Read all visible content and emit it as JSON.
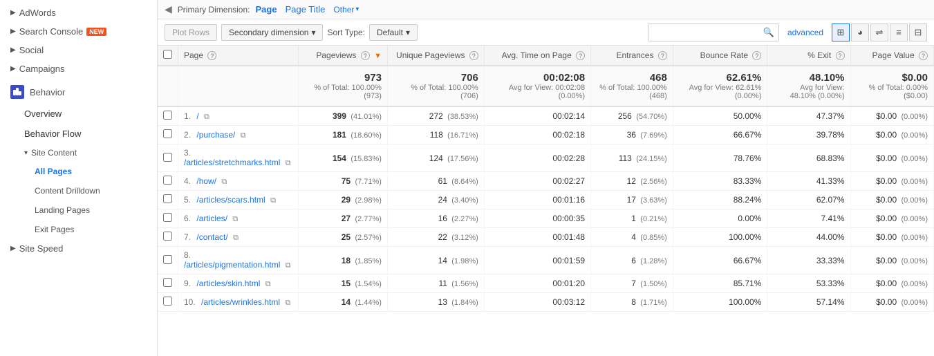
{
  "sidebar": {
    "items": [
      {
        "label": "AdWords",
        "type": "section",
        "arrow": "▶"
      },
      {
        "label": "Search Console",
        "type": "section",
        "arrow": "▶",
        "badge": "NEW"
      },
      {
        "label": "Social",
        "type": "section",
        "arrow": "▶"
      },
      {
        "label": "Campaigns",
        "type": "section",
        "arrow": "▶"
      },
      {
        "label": "Behavior",
        "type": "behavior"
      },
      {
        "label": "Overview",
        "type": "sub"
      },
      {
        "label": "Behavior Flow",
        "type": "sub"
      },
      {
        "label": "Site Content",
        "type": "site-content",
        "arrow": "▾"
      },
      {
        "label": "All Pages",
        "type": "subsub",
        "active": true
      },
      {
        "label": "Content Drilldown",
        "type": "subsub"
      },
      {
        "label": "Landing Pages",
        "type": "subsub"
      },
      {
        "label": "Exit Pages",
        "type": "subsub"
      },
      {
        "label": "Site Speed",
        "type": "section",
        "arrow": "▶"
      }
    ]
  },
  "dimension_tabs": {
    "label": "Primary Dimension:",
    "tabs": [
      {
        "label": "Page",
        "active": true
      },
      {
        "label": "Page Title",
        "active": false
      },
      {
        "label": "Other",
        "active": false,
        "dropdown": true
      }
    ]
  },
  "toolbar": {
    "plot_rows": "Plot Rows",
    "secondary_dimension": "Secondary dimension",
    "sort_type_label": "Sort Type:",
    "sort_default": "Default",
    "advanced": "advanced",
    "search_placeholder": ""
  },
  "table": {
    "columns": [
      {
        "key": "page",
        "label": "Page",
        "help": true,
        "numeric": false
      },
      {
        "key": "pageviews",
        "label": "Pageviews",
        "help": true,
        "sort": true,
        "numeric": true
      },
      {
        "key": "unique_pageviews",
        "label": "Unique Pageviews",
        "help": true,
        "numeric": true
      },
      {
        "key": "avg_time",
        "label": "Avg. Time on Page",
        "help": true,
        "numeric": true
      },
      {
        "key": "entrances",
        "label": "Entrances",
        "help": true,
        "numeric": true
      },
      {
        "key": "bounce_rate",
        "label": "Bounce Rate",
        "help": true,
        "numeric": true
      },
      {
        "key": "pct_exit",
        "label": "% Exit",
        "help": true,
        "numeric": true
      },
      {
        "key": "page_value",
        "label": "Page Value",
        "help": true,
        "numeric": true
      }
    ],
    "summary": {
      "pageviews": "973",
      "pageviews_sub": "% of Total: 100.00% (973)",
      "unique_pageviews": "706",
      "unique_pageviews_sub": "% of Total: 100.00% (706)",
      "avg_time": "00:02:08",
      "avg_time_sub": "Avg for View: 00:02:08 (0.00%)",
      "entrances": "468",
      "entrances_sub": "% of Total: 100.00% (468)",
      "bounce_rate": "62.61%",
      "bounce_rate_sub": "Avg for View: 62.61% (0.00%)",
      "pct_exit": "48.10%",
      "pct_exit_sub": "Avg for View: 48.10% (0.00%)",
      "page_value": "$0.00",
      "page_value_sub": "% of Total: 0.00% ($0.00)"
    },
    "rows": [
      {
        "num": "1.",
        "page": "/",
        "pageviews": "399",
        "pv_pct": "(41.01%)",
        "unique_pv": "272",
        "upv_pct": "(38.53%)",
        "avg_time": "00:02:14",
        "entrances": "256",
        "ent_pct": "(54.70%)",
        "bounce_rate": "50.00%",
        "pct_exit": "47.37%",
        "page_value": "$0.00",
        "pv_val_pct": "(0.00%)"
      },
      {
        "num": "2.",
        "page": "/purchase/",
        "pageviews": "181",
        "pv_pct": "(18.60%)",
        "unique_pv": "118",
        "upv_pct": "(16.71%)",
        "avg_time": "00:02:18",
        "entrances": "36",
        "ent_pct": "(7.69%)",
        "bounce_rate": "66.67%",
        "pct_exit": "39.78%",
        "page_value": "$0.00",
        "pv_val_pct": "(0.00%)"
      },
      {
        "num": "3.",
        "page": "/articles/stretchmarks.html",
        "pageviews": "154",
        "pv_pct": "(15.83%)",
        "unique_pv": "124",
        "upv_pct": "(17.56%)",
        "avg_time": "00:02:28",
        "entrances": "113",
        "ent_pct": "(24.15%)",
        "bounce_rate": "78.76%",
        "pct_exit": "68.83%",
        "page_value": "$0.00",
        "pv_val_pct": "(0.00%)"
      },
      {
        "num": "4.",
        "page": "/how/",
        "pageviews": "75",
        "pv_pct": "(7.71%)",
        "unique_pv": "61",
        "upv_pct": "(8.64%)",
        "avg_time": "00:02:27",
        "entrances": "12",
        "ent_pct": "(2.56%)",
        "bounce_rate": "83.33%",
        "pct_exit": "41.33%",
        "page_value": "$0.00",
        "pv_val_pct": "(0.00%)"
      },
      {
        "num": "5.",
        "page": "/articles/scars.html",
        "pageviews": "29",
        "pv_pct": "(2.98%)",
        "unique_pv": "24",
        "upv_pct": "(3.40%)",
        "avg_time": "00:01:16",
        "entrances": "17",
        "ent_pct": "(3.63%)",
        "bounce_rate": "88.24%",
        "pct_exit": "62.07%",
        "page_value": "$0.00",
        "pv_val_pct": "(0.00%)"
      },
      {
        "num": "6.",
        "page": "/articles/",
        "pageviews": "27",
        "pv_pct": "(2.77%)",
        "unique_pv": "16",
        "upv_pct": "(2.27%)",
        "avg_time": "00:00:35",
        "entrances": "1",
        "ent_pct": "(0.21%)",
        "bounce_rate": "0.00%",
        "pct_exit": "7.41%",
        "page_value": "$0.00",
        "pv_val_pct": "(0.00%)"
      },
      {
        "num": "7.",
        "page": "/contact/",
        "pageviews": "25",
        "pv_pct": "(2.57%)",
        "unique_pv": "22",
        "upv_pct": "(3.12%)",
        "avg_time": "00:01:48",
        "entrances": "4",
        "ent_pct": "(0.85%)",
        "bounce_rate": "100.00%",
        "pct_exit": "44.00%",
        "page_value": "$0.00",
        "pv_val_pct": "(0.00%)"
      },
      {
        "num": "8.",
        "page": "/articles/pigmentation.html",
        "pageviews": "18",
        "pv_pct": "(1.85%)",
        "unique_pv": "14",
        "upv_pct": "(1.98%)",
        "avg_time": "00:01:59",
        "entrances": "6",
        "ent_pct": "(1.28%)",
        "bounce_rate": "66.67%",
        "pct_exit": "33.33%",
        "page_value": "$0.00",
        "pv_val_pct": "(0.00%)"
      },
      {
        "num": "9.",
        "page": "/articles/skin.html",
        "pageviews": "15",
        "pv_pct": "(1.54%)",
        "unique_pv": "11",
        "upv_pct": "(1.56%)",
        "avg_time": "00:01:20",
        "entrances": "7",
        "ent_pct": "(1.50%)",
        "bounce_rate": "85.71%",
        "pct_exit": "53.33%",
        "page_value": "$0.00",
        "pv_val_pct": "(0.00%)"
      },
      {
        "num": "10.",
        "page": "/articles/wrinkles.html",
        "pageviews": "14",
        "pv_pct": "(1.44%)",
        "unique_pv": "13",
        "upv_pct": "(1.84%)",
        "avg_time": "00:03:12",
        "entrances": "8",
        "ent_pct": "(1.71%)",
        "bounce_rate": "100.00%",
        "pct_exit": "57.14%",
        "page_value": "$0.00",
        "pv_val_pct": "(0.00%)"
      }
    ]
  }
}
